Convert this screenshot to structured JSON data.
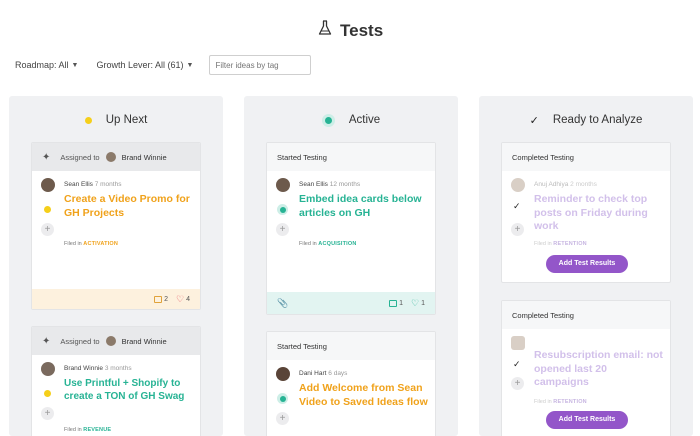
{
  "page": {
    "title": "Tests"
  },
  "filters": {
    "roadmap": "Roadmap: All",
    "growth_lever": "Growth Lever: All (61)",
    "tag_placeholder": "Filter ideas by tag"
  },
  "columns": [
    {
      "title": "Up Next",
      "cards": [
        {
          "header_label": "Assigned to",
          "assignee": "Brand Winnie",
          "author": "Sean Ellis",
          "ago": "7 months",
          "title": "Create a Video Promo for GH Projects",
          "filed_label": "Filed in",
          "category": "ACTIVATION",
          "comments": "2",
          "likes": "4"
        },
        {
          "header_label": "Assigned to",
          "assignee": "Brand Winnie",
          "author": "Brand Winnie",
          "ago": "3 months",
          "title": "Use Printful + Shopify to create a TON of GH Swag",
          "filed_label": "Filed in",
          "category": "REVENUE"
        }
      ]
    },
    {
      "title": "Active",
      "cards": [
        {
          "header_label": "Started Testing",
          "author": "Sean Ellis",
          "ago": "12 months",
          "title": "Embed idea cards below articles on GH",
          "filed_label": "Filed in",
          "category": "ACQUISITION",
          "comments": "1",
          "likes": "1"
        },
        {
          "header_label": "Started Testing",
          "author": "Dani Hart",
          "ago": "6 days",
          "title": "Add Welcome from Sean Video to Saved Ideas flow"
        }
      ]
    },
    {
      "title": "Ready to Analyze",
      "cards": [
        {
          "header_label": "Completed Testing",
          "author": "Anuj Adhiya",
          "ago": "2 months",
          "title": "Reminder to check top posts on Friday during work",
          "filed_label": "Filed in",
          "category": "RETENTION",
          "button": "Add Test Results"
        },
        {
          "header_label": "Completed Testing",
          "title": "Resubscription email: not opened last 20 campaigns",
          "filed_label": "Filed in",
          "category": "RETENTION",
          "button": "Add Test Results"
        }
      ]
    }
  ],
  "icons": {
    "flask": "flask-icon",
    "wand": "wand-icon",
    "check": "check-icon",
    "plus": "plus-icon",
    "comment": "comment-icon",
    "heart": "heart-icon",
    "paperclip": "paperclip-icon"
  },
  "colors": {
    "orange": "#f0a21b",
    "teal": "#27b394",
    "purple": "#9356c9",
    "yellow": "#f5cf1a"
  }
}
